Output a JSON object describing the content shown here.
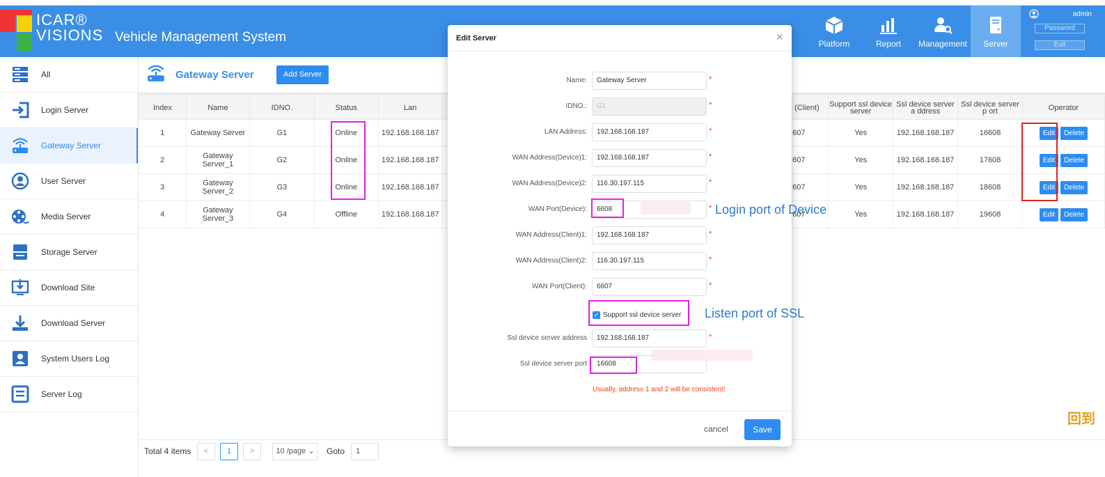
{
  "app": {
    "brand_line1": "ICAR®",
    "brand_line2": "VISIONS",
    "title": "Vehicle Management System"
  },
  "topnav": [
    {
      "label": "Platform",
      "icon": "cube-icon"
    },
    {
      "label": "Report",
      "icon": "bar-chart-icon"
    },
    {
      "label": "Management",
      "icon": "user-search-icon"
    },
    {
      "label": "Server",
      "icon": "server-icon"
    }
  ],
  "account": {
    "username": "admin",
    "password_label": "Password",
    "exit_label": "Exit"
  },
  "sidebar": {
    "items": [
      {
        "label": "All",
        "icon": "server-list-icon"
      },
      {
        "label": "Login Server",
        "icon": "login-icon"
      },
      {
        "label": "Gateway Server",
        "icon": "router-icon"
      },
      {
        "label": "User Server",
        "icon": "user-circle-icon"
      },
      {
        "label": "Media Server",
        "icon": "film-reel-icon"
      },
      {
        "label": "Storage Server",
        "icon": "storage-icon"
      },
      {
        "label": "Download Site",
        "icon": "monitor-download-icon"
      },
      {
        "label": "Download Server",
        "icon": "download-icon"
      },
      {
        "label": "System Users Log",
        "icon": "user-card-icon"
      },
      {
        "label": "Server Log",
        "icon": "log-icon"
      }
    ]
  },
  "page": {
    "title": "Gateway Server",
    "add_label": "Add Server"
  },
  "table": {
    "headers": {
      "index": "Index",
      "name": "Name",
      "idno": "IDNO.",
      "status": "Status",
      "lan": "Lan",
      "client_port": "(Client)",
      "ssl_support": "Support ssl device server",
      "ssl_address": "Ssl device server a ddress",
      "ssl_port": "Ssl device server p ort",
      "operator": "Operator"
    },
    "rows": [
      {
        "index": "1",
        "name": "Gateway Server",
        "idno": "G1",
        "status": "Online",
        "lan": "192.168.168.187",
        "client_port": "607",
        "ssl_support": "Yes",
        "ssl_address": "192.168.168.187",
        "ssl_port": "16608"
      },
      {
        "index": "2",
        "name": "Gateway Server_1",
        "idno": "G2",
        "status": "Online",
        "lan": "192.168.168.187",
        "client_port": "607",
        "ssl_support": "Yes",
        "ssl_address": "192.168.168.187",
        "ssl_port": "17608"
      },
      {
        "index": "3",
        "name": "Gateway Server_2",
        "idno": "G3",
        "status": "Online",
        "lan": "192.168.168.187",
        "client_port": "607",
        "ssl_support": "Yes",
        "ssl_address": "192.168.168.187",
        "ssl_port": "18608"
      },
      {
        "index": "4",
        "name": "Gateway Server_3",
        "idno": "G4",
        "status": "Offline",
        "lan": "192.168.168.187",
        "client_port": "607",
        "ssl_support": "Yes",
        "ssl_address": "192.168.168.187",
        "ssl_port": "19608"
      }
    ],
    "edit_label": "Edit",
    "delete_label": "Delete"
  },
  "pager": {
    "total": "Total 4 items",
    "prev": "<",
    "page": "1",
    "next": ">",
    "per_page": "10 /page",
    "goto_label": "Goto",
    "goto_value": "1"
  },
  "modal": {
    "title": "Edit Server",
    "close": "×",
    "fields": {
      "name_label": "Name:",
      "name_value": "Gateway Server",
      "idno_label": "IDNO.:",
      "idno_value": "G1",
      "lan_label": "LAN Address:",
      "lan_value": "192.168.168.187",
      "wan_dev1_label": "WAN Address(Device)1:",
      "wan_dev1_value": "192.168.168.187",
      "wan_dev2_label": "WAN Address(Device)2:",
      "wan_dev2_value": "116.30.197.115",
      "wan_port_dev_label": "WAN Port(Device):",
      "wan_port_dev_value": "6608",
      "wan_cli1_label": "WAN Address(Client)1:",
      "wan_cli1_value": "192.168.168.187",
      "wan_cli2_label": "WAN Address(Client)2:",
      "wan_cli2_value": "116.30.197.115",
      "wan_port_cli_label": "WAN Port(Client):",
      "wan_port_cli_value": "6607",
      "ssl_checkbox_label": "Support ssl device server",
      "ssl_addr_label": "Ssl device server address",
      "ssl_addr_value": "192.168.168.187",
      "ssl_port_label": "Ssl device server port",
      "ssl_port_value": "16608"
    },
    "required_mark": "*",
    "warning": "Usually, address 1 and 2 will be consistent!",
    "cancel_label": "cancel",
    "save_label": "Save"
  },
  "annotations": {
    "login_port_note": "Login port of Device",
    "ssl_port_note": "Listen port of SSL",
    "side_glyph": "回到"
  },
  "colors": {
    "header": "#3a8ee6",
    "primary": "#2d8cf0",
    "highlight": "#e020e0",
    "highlight_red": "#e02020",
    "danger": "#ed4014"
  }
}
